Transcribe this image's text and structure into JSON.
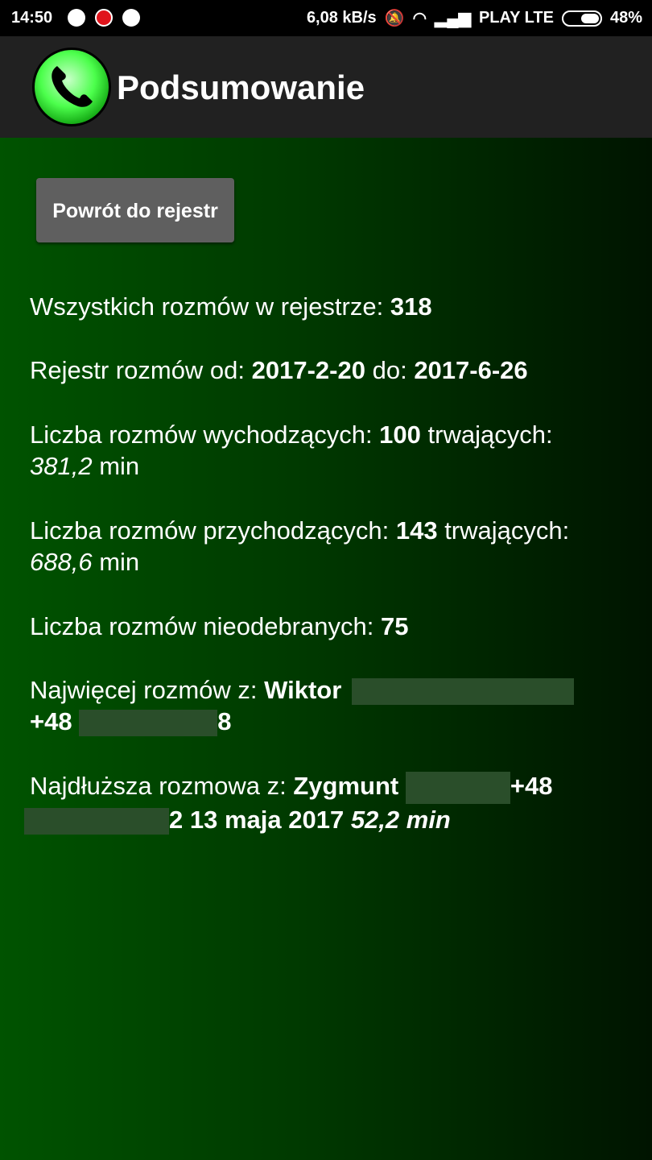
{
  "status_bar": {
    "time": "14:50",
    "speed": "6,08 kB/s",
    "carrier": "PLAY LTE",
    "battery": "48%",
    "icons": [
      "whatsapp-icon",
      "stop-icon",
      "phone-call-icon",
      "mute-bell-icon",
      "wifi-icon",
      "signal-icon",
      "battery-icon"
    ]
  },
  "app_bar": {
    "title": "Podsumowanie",
    "logo_icon": "phone-handset-icon"
  },
  "back_button": {
    "label": "Powrót do rejestr"
  },
  "stats": {
    "total": {
      "label": "Wszystkich rozmów w rejestrze: ",
      "value": "318"
    },
    "range": {
      "label_from": "Rejestr rozmów od: ",
      "from": "2017-2-20",
      "label_to": " do: ",
      "to": "2017-6-26"
    },
    "outgoing": {
      "label": "Liczba rozmów wychodzących: ",
      "count": "100",
      "label_dur": " trwających:",
      "duration": "381,2",
      "unit": " min"
    },
    "incoming": {
      "label": "Liczba rozmów przychodzących: ",
      "count": "143",
      "label_dur": " trwających:",
      "duration": "688,6",
      "unit": " min"
    },
    "missed": {
      "label": "Liczba rozmów nieodebranych: ",
      "count": "75"
    },
    "most_calls": {
      "label": "Najwięcej rozmów z: ",
      "name": "Wiktor",
      "prefix": "+48",
      "suffix": "8"
    },
    "longest": {
      "label": "Najdłuższa rozmowa z: ",
      "name": "Zygmunt",
      "prefix": "+48",
      "date": "2 13 maja 2017",
      "duration": "52,2 min"
    }
  },
  "colors": {
    "status_bar": "#000000",
    "app_bar": "#212121",
    "button": "#5f5f5f",
    "gradient_start": "#005300",
    "gradient_end": "#001400",
    "redaction": "#2a4e2a"
  }
}
